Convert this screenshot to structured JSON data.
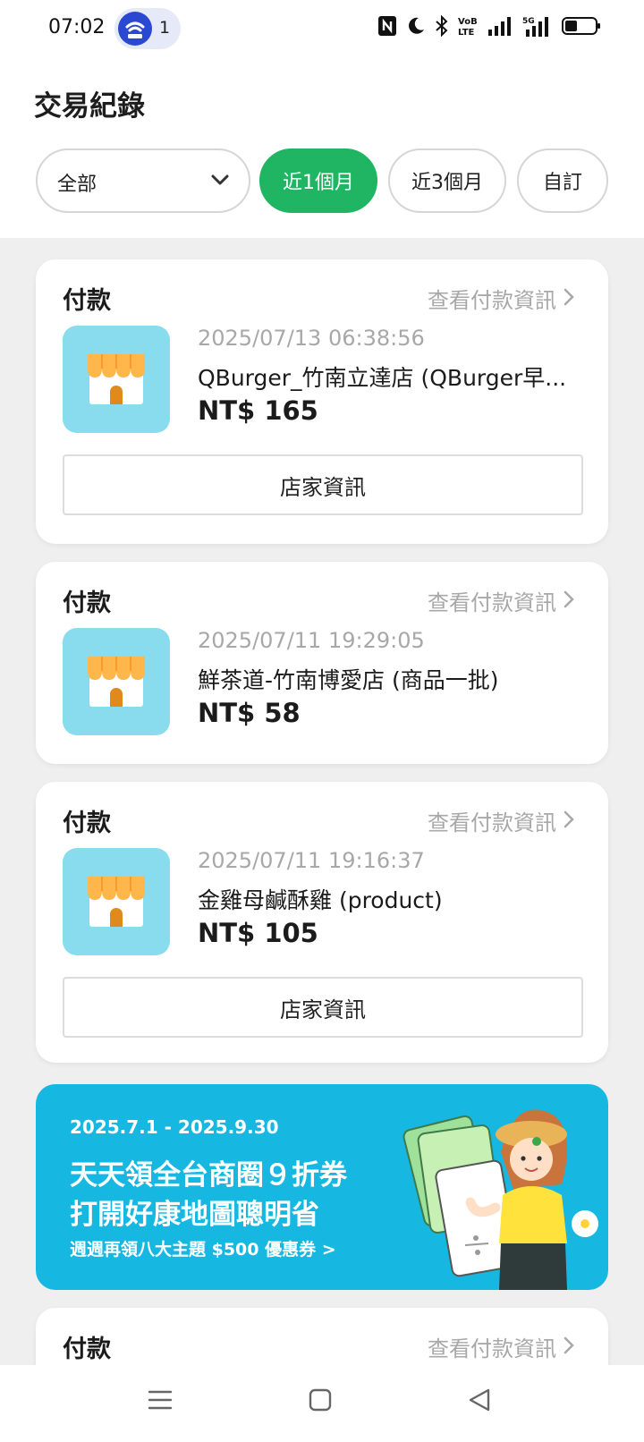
{
  "status_bar": {
    "time": "07:02",
    "notification_count": "1",
    "icons": [
      "nfc-icon",
      "moon-icon",
      "bluetooth-icon",
      "volte-icon",
      "signal-icon",
      "5g-signal-icon",
      "battery-icon"
    ]
  },
  "header": {
    "title": "交易紀錄"
  },
  "filters": {
    "type_select": {
      "value": "全部"
    },
    "periods": [
      {
        "label": "近1個月",
        "active": true
      },
      {
        "label": "近3個月",
        "active": false
      },
      {
        "label": "自訂",
        "active": false
      }
    ]
  },
  "transactions": [
    {
      "type": "付款",
      "link": "查看付款資訊",
      "datetime": "2025/07/13 06:38:56",
      "name": "QBurger_竹南立達店 (QBurger早...",
      "amount": "NT$ 165",
      "store_button": "店家資訊"
    },
    {
      "type": "付款",
      "link": "查看付款資訊",
      "datetime": "2025/07/11 19:29:05",
      "name": "鮮茶道-竹南博愛店 (商品一批)",
      "amount": "NT$ 58"
    },
    {
      "type": "付款",
      "link": "查看付款資訊",
      "datetime": "2025/07/11 19:16:37",
      "name": "金雞母鹹酥雞 (product)",
      "amount": "NT$ 105",
      "store_button": "店家資訊"
    },
    {
      "type": "付款",
      "link": "查看付款資訊"
    }
  ],
  "banner": {
    "date_range": "2025.7.1 - 2025.9.30",
    "line1": "天天領全台商圈９折券",
    "line2": "打開好康地圖聰明省",
    "subline": "週週再領八大主題 $500 優惠券 >"
  },
  "nav_bar": {
    "icons": [
      "menu-icon",
      "home-square-icon",
      "back-triangle-icon"
    ]
  },
  "colors": {
    "accent": "#1fb562",
    "banner_bg": "#16b8e2",
    "store_icon_bg": "#88dcee"
  }
}
